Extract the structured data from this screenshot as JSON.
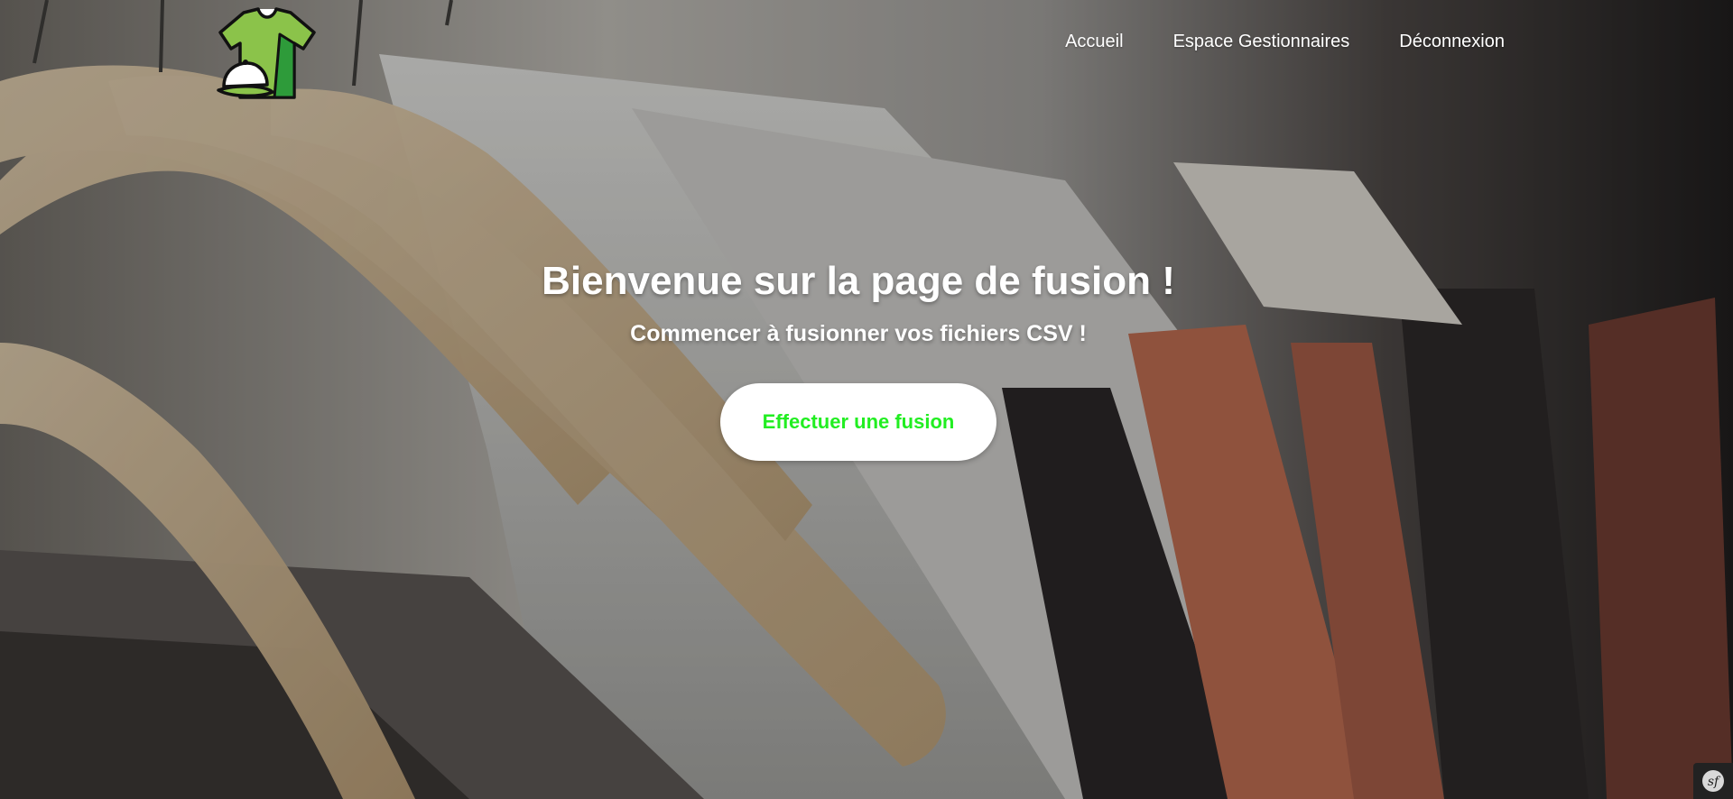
{
  "header": {
    "logo_icon": "tshirt-cap-logo-icon",
    "nav": [
      {
        "label": "Accueil"
      },
      {
        "label": "Espace Gestionnaires"
      },
      {
        "label": "Déconnexion"
      }
    ]
  },
  "hero": {
    "title": "Bienvenue sur la page de fusion !",
    "subtitle": "Commencer à fusionner vos fichiers CSV !",
    "cta_label": "Effectuer une fusion"
  },
  "footer": {
    "toolbar_icon": "symfony-icon"
  },
  "colors": {
    "cta_text": "#22ee22",
    "logo_green": "#8bc34a",
    "logo_dark_green": "#2e9b3a"
  }
}
